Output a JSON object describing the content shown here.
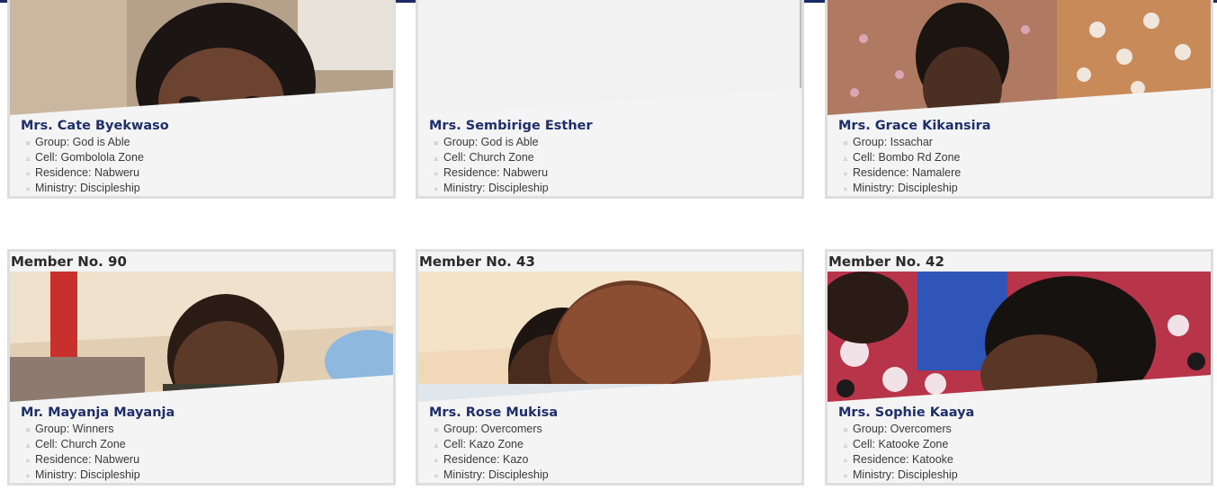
{
  "colors": {
    "accent": "#1f2f6b",
    "card_bg": "#f4f4f4",
    "card_border": "#dedede"
  },
  "icons": {
    "group": "book-icon",
    "cell": "pin-icon",
    "residence": "map-marker-icon",
    "ministry": "map-marker-icon"
  },
  "cards": [
    {
      "title": "",
      "name": "Mrs. Cate Byekwaso",
      "group": "Group: God is Able",
      "cell": "Cell: Gombolola Zone",
      "residence": "Residence: Nabweru",
      "ministry": "Ministry: Discipleship"
    },
    {
      "title": "",
      "name": "Mrs. Sembirige Esther",
      "group": "Group: God is Able",
      "cell": "Cell: Church Zone",
      "residence": "Residence: Nabweru",
      "ministry": "Ministry: Discipleship"
    },
    {
      "title": "",
      "name": "Mrs. Grace Kikansira",
      "group": "Group: Issachar",
      "cell": "Cell: Bombo Rd Zone",
      "residence": "Residence: Namalere",
      "ministry": "Ministry: Discipleship"
    },
    {
      "title": "Member No. 90",
      "name": "Mr. Mayanja Mayanja",
      "group": "Group: Winners",
      "cell": "Cell: Church Zone",
      "residence": "Residence: Nabweru",
      "ministry": "Ministry: Discipleship"
    },
    {
      "title": "Member No. 43",
      "name": "Mrs. Rose Mukisa",
      "group": "Group: Overcomers",
      "cell": "Cell: Kazo Zone",
      "residence": "Residence: Kazo",
      "ministry": "Ministry: Discipleship"
    },
    {
      "title": "Member No. 42",
      "name": "Mrs. Sophie Kaaya",
      "group": "Group: Overcomers",
      "cell": "Cell: Katooke Zone",
      "residence": "Residence: Katooke",
      "ministry": "Ministry: Discipleship"
    }
  ]
}
